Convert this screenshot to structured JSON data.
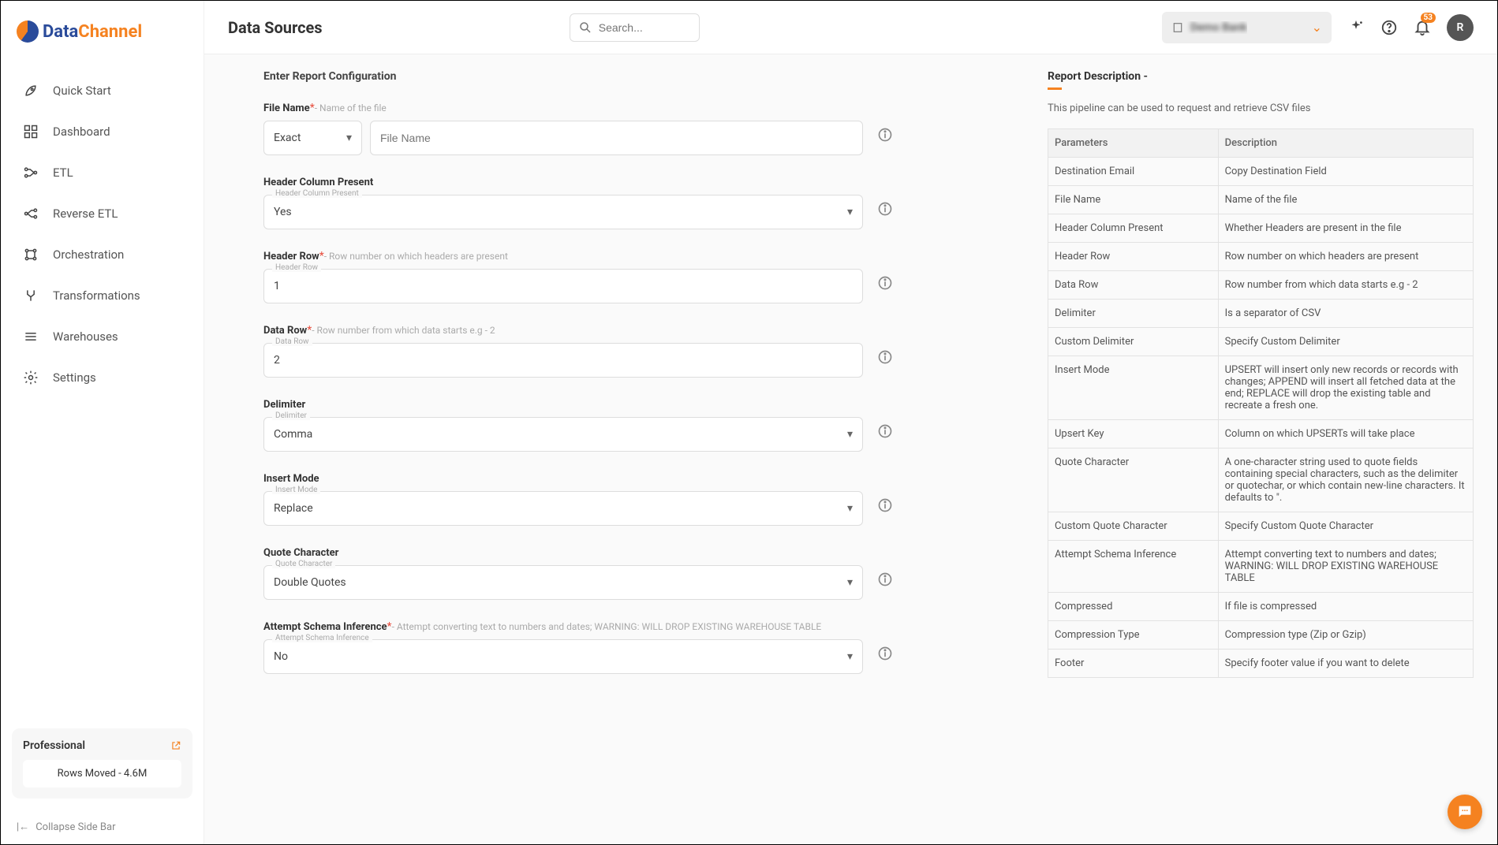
{
  "brand": {
    "part1": "Data",
    "part2": "Channel"
  },
  "header": {
    "title": "Data Sources",
    "search_placeholder": "Search...",
    "org_name": "Demo Bank",
    "notif_count": "53",
    "avatar_letter": "R"
  },
  "nav": {
    "items": [
      {
        "label": "Quick Start"
      },
      {
        "label": "Dashboard"
      },
      {
        "label": "ETL"
      },
      {
        "label": "Reverse ETL"
      },
      {
        "label": "Orchestration"
      },
      {
        "label": "Transformations"
      },
      {
        "label": "Warehouses"
      },
      {
        "label": "Settings"
      }
    ]
  },
  "plan": {
    "name": "Professional",
    "rows": "Rows Moved - 4.6M"
  },
  "collapse_label": "Collapse Side Bar",
  "form": {
    "title": "Enter Report Configuration",
    "fields": {
      "file_name": {
        "label": "File Name",
        "hint": "- Name of the file",
        "match_mode": "Exact",
        "placeholder": "File Name"
      },
      "header_present": {
        "label": "Header Column Present",
        "mini": "Header Column Present",
        "value": "Yes"
      },
      "header_row": {
        "label": "Header Row",
        "hint": "- Row number on which headers are present",
        "mini": "Header Row",
        "value": "1"
      },
      "data_row": {
        "label": "Data Row",
        "hint": "- Row number from which data starts e.g - 2",
        "mini": "Data Row",
        "value": "2"
      },
      "delimiter": {
        "label": "Delimiter",
        "mini": "Delimiter",
        "value": "Comma"
      },
      "insert_mode": {
        "label": "Insert Mode",
        "mini": "Insert Mode",
        "value": "Replace"
      },
      "quote_char": {
        "label": "Quote Character",
        "mini": "Quote Character",
        "value": "Double Quotes"
      },
      "schema_inf": {
        "label": "Attempt Schema Inference",
        "hint": "- Attempt converting text to numbers and dates; WARNING: WILL DROP EXISTING WAREHOUSE TABLE",
        "mini": "Attempt Schema Inference",
        "value": "No"
      }
    }
  },
  "desc": {
    "title": "Report Description -",
    "text": "This pipeline can be used to request and retrieve CSV files",
    "th_param": "Parameters",
    "th_desc": "Description",
    "rows": [
      {
        "p": "Destination Email",
        "d": "Copy Destination Field"
      },
      {
        "p": "File Name",
        "d": "Name of the file"
      },
      {
        "p": "Header Column Present",
        "d": "Whether Headers are present in the file"
      },
      {
        "p": "Header Row",
        "d": "Row number on which headers are present"
      },
      {
        "p": "Data Row",
        "d": "Row number from which data starts e.g - 2"
      },
      {
        "p": "Delimiter",
        "d": "Is a separator of CSV"
      },
      {
        "p": "Custom Delimiter",
        "d": "Specify Custom Delimiter"
      },
      {
        "p": "Insert Mode",
        "d": "UPSERT will insert only new records or records with changes; APPEND will insert all fetched data at the end; REPLACE will drop the existing table and recreate a fresh one."
      },
      {
        "p": "Upsert Key",
        "d": "Column on which UPSERTs will take place"
      },
      {
        "p": "Quote Character",
        "d": "A one-character string used to quote fields containing special characters, such as the delimiter or quotechar, or which contain new-line characters. It defaults to \"."
      },
      {
        "p": "Custom Quote Character",
        "d": "Specify Custom Quote Character"
      },
      {
        "p": "Attempt Schema Inference",
        "d": "Attempt converting text to numbers and dates; WARNING: WILL DROP EXISTING WAREHOUSE TABLE"
      },
      {
        "p": "Compressed",
        "d": "If file is compressed"
      },
      {
        "p": "Compression Type",
        "d": "Compression type (Zip or Gzip)"
      },
      {
        "p": "Footer",
        "d": "Specify footer value if you want to delete"
      }
    ]
  }
}
